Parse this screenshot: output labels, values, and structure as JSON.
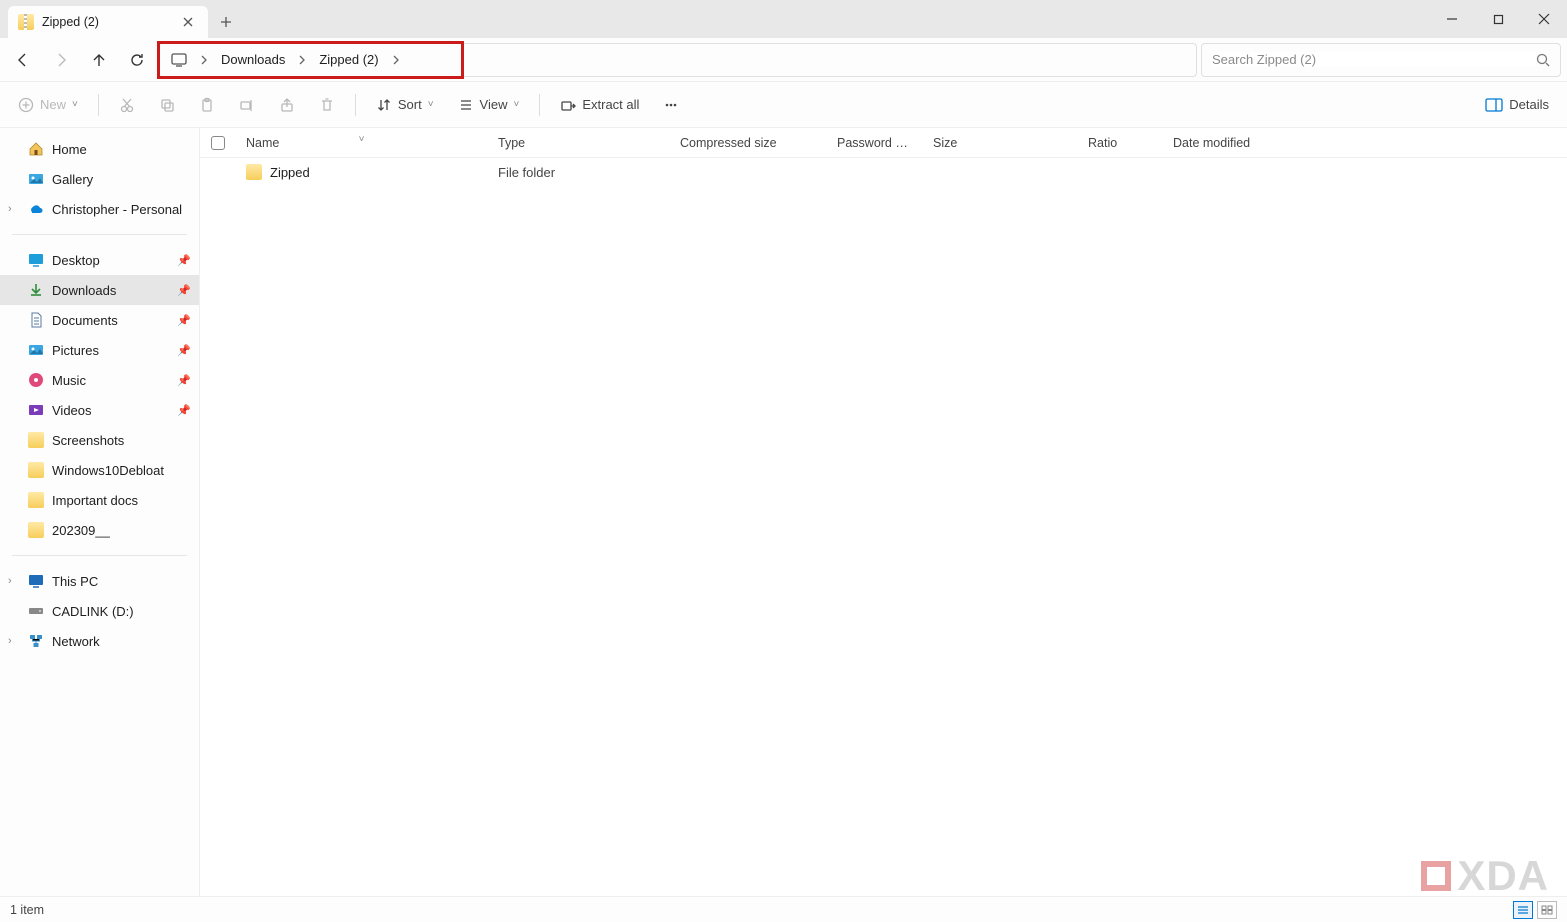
{
  "titlebar": {
    "tab_title": "Zipped (2)"
  },
  "breadcrumb": {
    "segments": [
      "Downloads",
      "Zipped (2)"
    ]
  },
  "search": {
    "placeholder": "Search Zipped (2)"
  },
  "toolbar": {
    "new_label": "New",
    "sort_label": "Sort",
    "view_label": "View",
    "extract_label": "Extract all",
    "details_label": "Details"
  },
  "sidebar": {
    "home": "Home",
    "gallery": "Gallery",
    "onedrive": "Christopher - Personal",
    "quick": {
      "desktop": "Desktop",
      "downloads": "Downloads",
      "documents": "Documents",
      "pictures": "Pictures",
      "music": "Music",
      "videos": "Videos",
      "screenshots": "Screenshots",
      "win10debloat": "Windows10Debloat",
      "important": "Important docs",
      "date": "202309__"
    },
    "thispc": "This PC",
    "cadlink": "CADLINK (D:)",
    "network": "Network"
  },
  "columns": {
    "name": "Name",
    "type": "Type",
    "compressed": "Compressed size",
    "password": "Password prot...",
    "size": "Size",
    "ratio": "Ratio",
    "date": "Date modified"
  },
  "rows": [
    {
      "name": "Zipped",
      "type": "File folder"
    }
  ],
  "statusbar": {
    "count": "1 item"
  },
  "watermark": "XDA"
}
